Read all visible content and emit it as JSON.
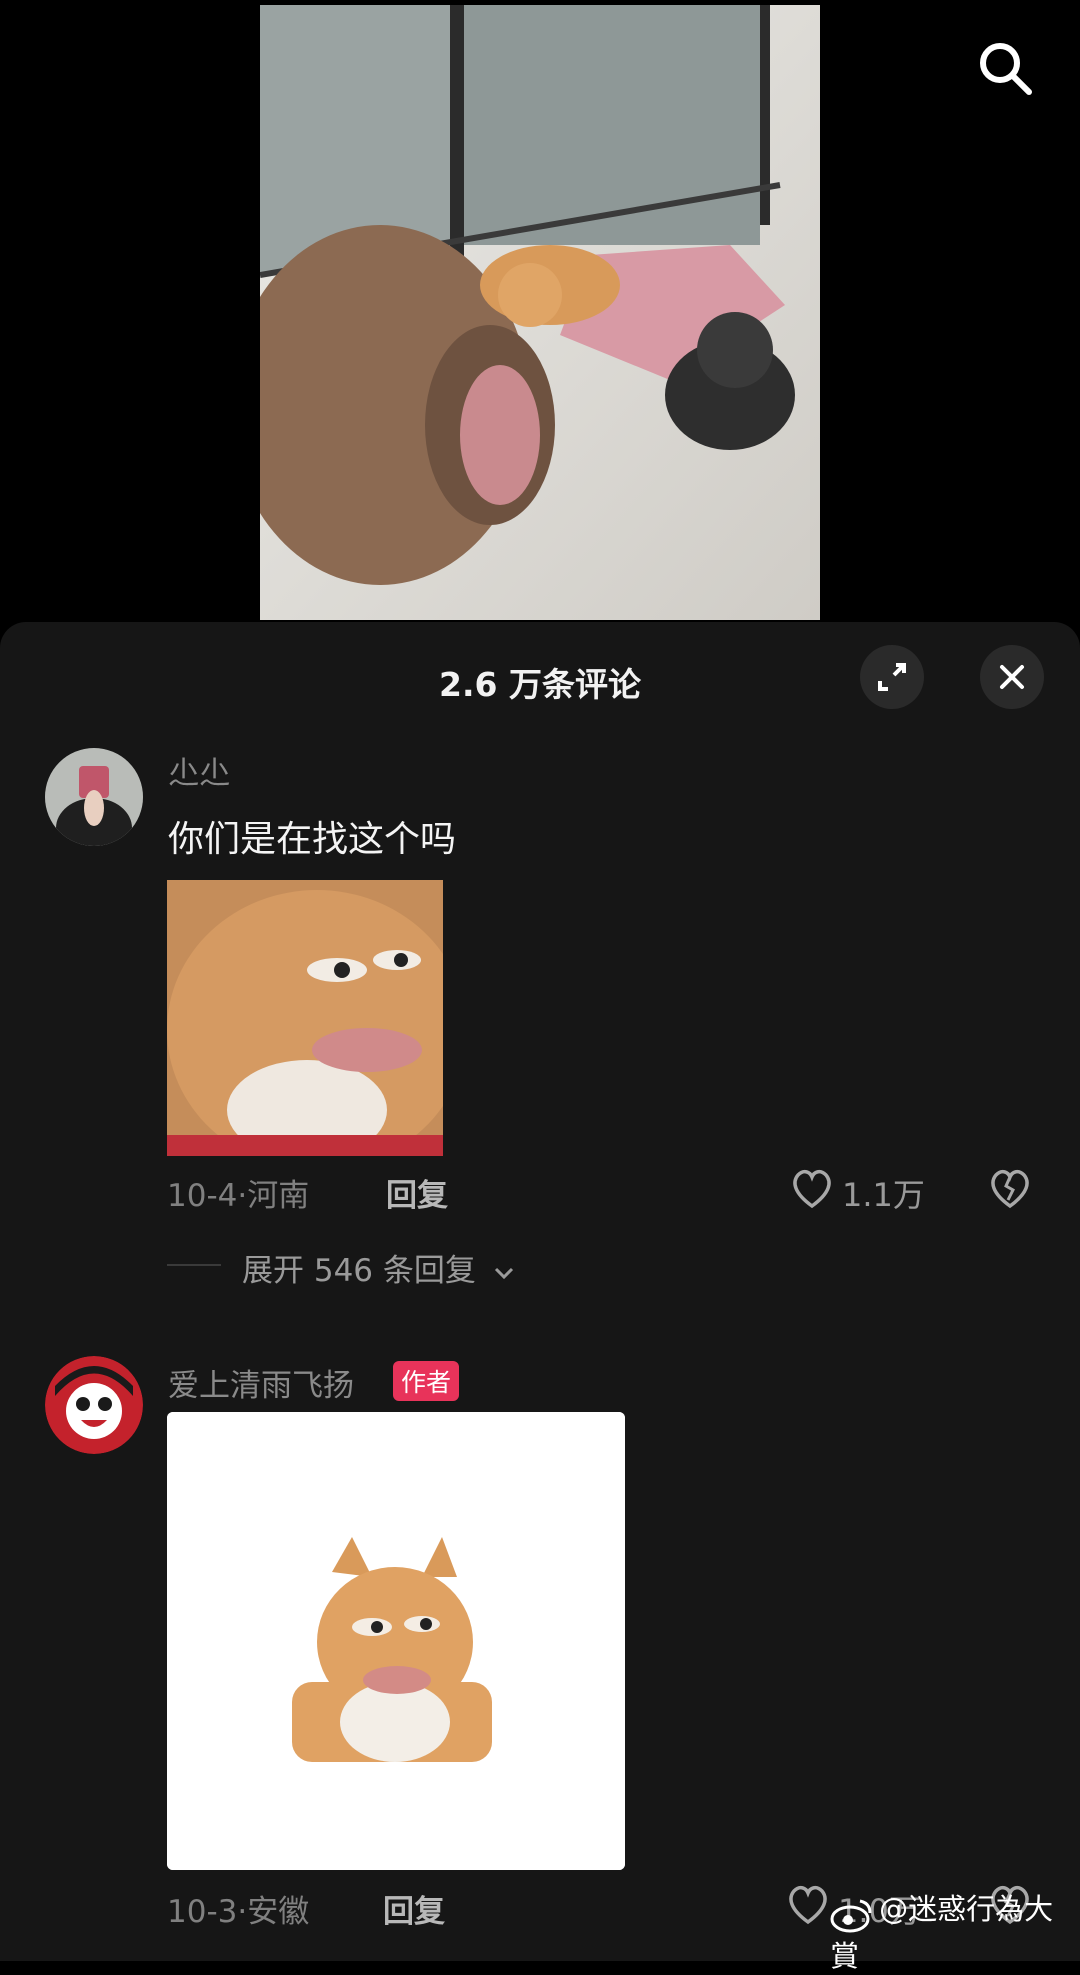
{
  "video": {
    "scene": "cat-and-dog-video"
  },
  "sheet": {
    "title": "2.6 万条评论"
  },
  "comments": [
    {
      "username": "尐尐",
      "text": "你们是在找这个吗",
      "date": "10-4",
      "location": "河南",
      "reply_label": "回复",
      "likes": "1.1万",
      "expand_replies": "展开 546 条回复"
    },
    {
      "username": "爱上清雨飞扬",
      "badge": "作者",
      "date": "10-3",
      "location": "安徽",
      "reply_label": "回复",
      "likes": "1.0万"
    }
  ],
  "watermark": "@迷惑行為大賞",
  "colors": {
    "sheet_bg": "#161616",
    "badge": "#e8335a",
    "page_bg": "#000000"
  }
}
